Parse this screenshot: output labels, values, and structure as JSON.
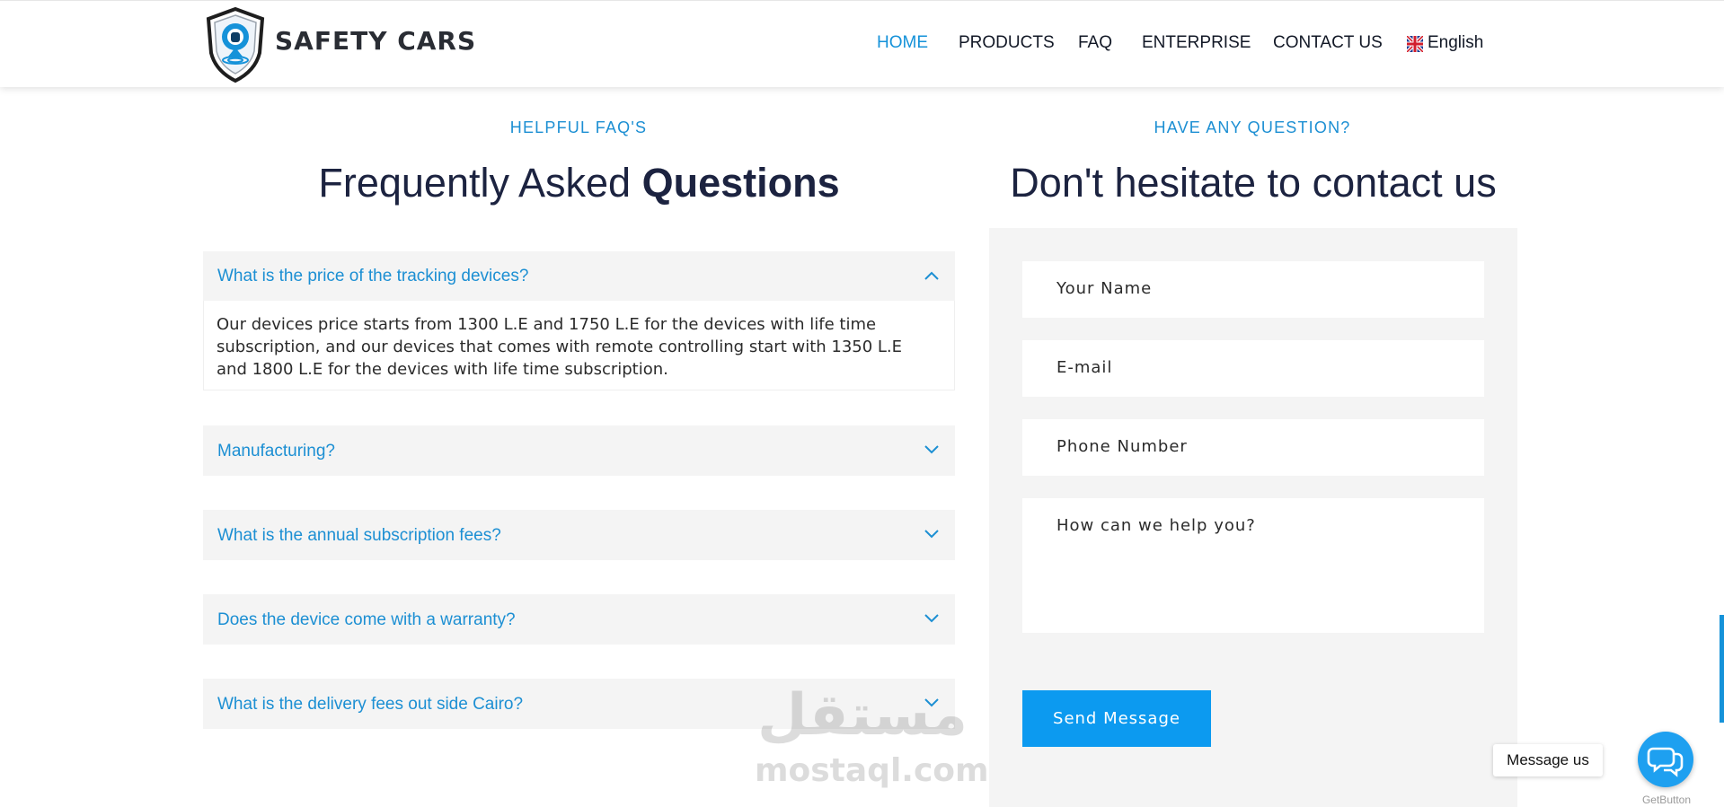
{
  "header": {
    "brand": "SAFETY CARS",
    "nav": [
      "HOME",
      "PRODUCTS",
      "FAQ",
      "ENTERPRISE",
      "CONTACT US"
    ],
    "language": "English"
  },
  "faq": {
    "kicker": "HELPFUL FAQ'S",
    "title_plain": "Frequently Asked",
    "title_bold": "Questions",
    "items": [
      {
        "q": "What is the price of the tracking devices?",
        "expanded": true,
        "a": "Our devices price starts from 1300 L.E and 1750 L.E for the devices with life time subscription, and our devices that comes with remote controlling start with 1350 L.E and 1800 L.E for the devices with life time subscription."
      },
      {
        "q": "Manufacturing?",
        "expanded": false
      },
      {
        "q": "What is the annual subscription fees?",
        "expanded": false
      },
      {
        "q": "Does the device come with a warranty?",
        "expanded": false
      },
      {
        "q": "What is the delivery fees out side Cairo?",
        "expanded": false
      }
    ]
  },
  "contact": {
    "kicker": "HAVE ANY QUESTION?",
    "title": "Don't hesitate to contact us",
    "fields": {
      "name": "Your Name",
      "email": "E-mail",
      "phone": "Phone Number",
      "message": "How can we help you?"
    },
    "send": "Send Message"
  },
  "watermark": {
    "arabic": "مستقل",
    "latin": "mostaql.com"
  },
  "chat": {
    "label": "Message us",
    "brand": "GetButton"
  },
  "colors": {
    "accent": "#1c8fd3",
    "button": "#0c9af0",
    "heading": "#1c2340"
  }
}
